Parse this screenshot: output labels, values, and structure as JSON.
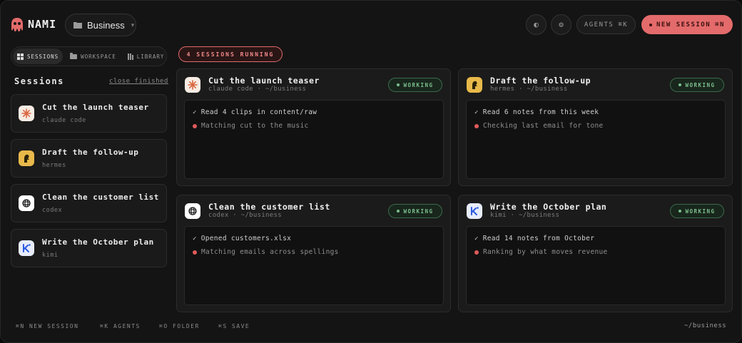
{
  "brand": {
    "name": "NAMI",
    "logo_icon": "octopus-mascot-icon",
    "accent": "#e46b6b"
  },
  "project": {
    "name": "Business"
  },
  "header": {
    "theme_icon": "contrast-icon",
    "settings_icon": "settings-icon",
    "agents_label": "AGENTS",
    "agents_shortcut": "⌘K",
    "new_session_label": "NEW SESSION",
    "new_session_shortcut": "⌘N"
  },
  "view_tabs": [
    {
      "label": "SESSIONS",
      "icon": "grid-icon",
      "active": true
    },
    {
      "label": "WORKSPACE",
      "icon": "folder-icon",
      "active": false
    },
    {
      "label": "LIBRARY",
      "icon": "library-icon",
      "active": false
    }
  ],
  "sidebar": {
    "title": "Sessions",
    "close_finished": "close finished",
    "items": [
      {
        "title": "Cut the launch teaser",
        "agent": "claude code",
        "icon": "claude-icon"
      },
      {
        "title": "Draft the follow-up",
        "agent": "hermes",
        "icon": "hermes-icon"
      },
      {
        "title": "Clean the customer list",
        "agent": "codex",
        "icon": "openai-icon"
      },
      {
        "title": "Write the October plan",
        "agent": "kimi",
        "icon": "kimi-icon"
      }
    ]
  },
  "running_label": "4 SESSIONS RUNNING",
  "cards": [
    {
      "title": "Cut the launch teaser",
      "subtitle": "claude code · ~/business",
      "status": "WORKING",
      "done": "Read 4 clips in content/raw",
      "current": "Matching cut to the music"
    },
    {
      "title": "Draft the follow-up",
      "subtitle": "hermes · ~/business",
      "status": "WORKING",
      "done": "Read 6 notes from this week",
      "current": "Checking last email for tone"
    },
    {
      "title": "Clean the customer list",
      "subtitle": "codex · ~/business",
      "status": "WORKING",
      "done": "Opened customers.xlsx",
      "current": "Matching emails across spellings"
    },
    {
      "title": "Write the October plan",
      "subtitle": "kimi · ~/business",
      "status": "WORKING",
      "done": "Read 14 notes from October",
      "current": "Ranking by what moves revenue"
    }
  ],
  "footer": {
    "shortcuts": [
      "⌘N NEW SESSION",
      "⌘K AGENTS",
      "⌘O FOLDER",
      "⌘S SAVE"
    ],
    "path": "~/business"
  },
  "colors": {
    "working": "#7cc08e",
    "active_dot": "#e05a5a",
    "background": "#141414"
  }
}
